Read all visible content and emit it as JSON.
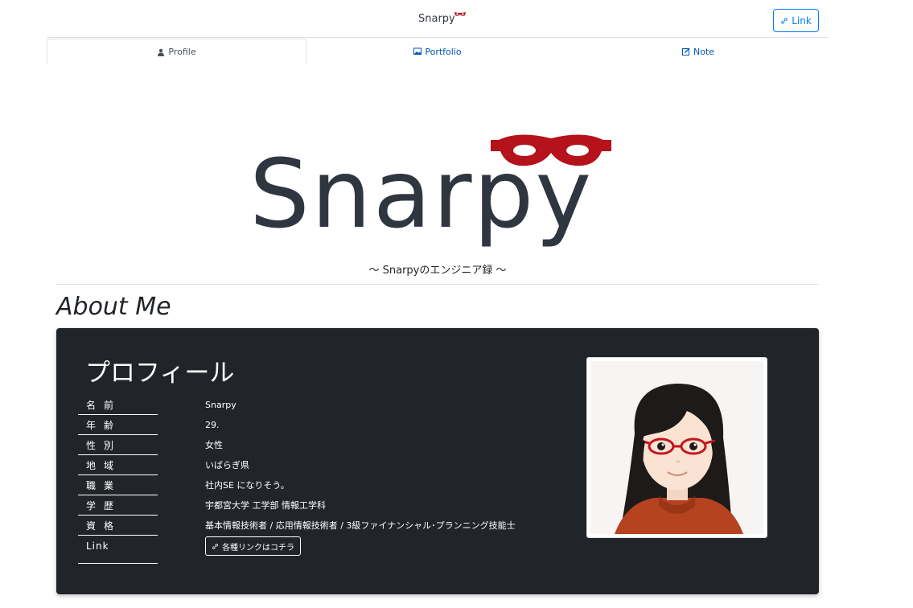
{
  "header": {
    "brand": "Snarpy",
    "link_button": "Link"
  },
  "tabs": [
    {
      "label": "Profile",
      "icon": "person-icon",
      "active": true
    },
    {
      "label": "Portfolio",
      "icon": "image-icon",
      "active": false
    },
    {
      "label": "Note",
      "icon": "edit-icon",
      "active": false
    }
  ],
  "hero": {
    "logo_text": "Snarpy",
    "tagline": "〜 Snarpyのエンジニア録 〜"
  },
  "about": {
    "heading": "About Me"
  },
  "profile": {
    "title": "プロフィール",
    "rows": [
      {
        "label": "名前",
        "value": "Snarpy"
      },
      {
        "label": "年齢",
        "value": "29."
      },
      {
        "label": "性別",
        "value": "女性"
      },
      {
        "label": "地域",
        "value": "いばらぎ県"
      },
      {
        "label": "職業",
        "value": "社内SE になりそう。"
      },
      {
        "label": "学歴",
        "value": "宇都宮大学 工学部 情報工学科"
      },
      {
        "label": "資格",
        "value": "基本情報技術者 / 応用情報技術者 / 3級ファイナンシャル･プランニング技能士"
      },
      {
        "label": "Link",
        "value": "各種リンクはコチラ"
      }
    ]
  },
  "colors": {
    "accent": "#007bff",
    "card_bg": "#212529",
    "mask_red": "#b5121b",
    "logo_dark": "#2f3640"
  }
}
